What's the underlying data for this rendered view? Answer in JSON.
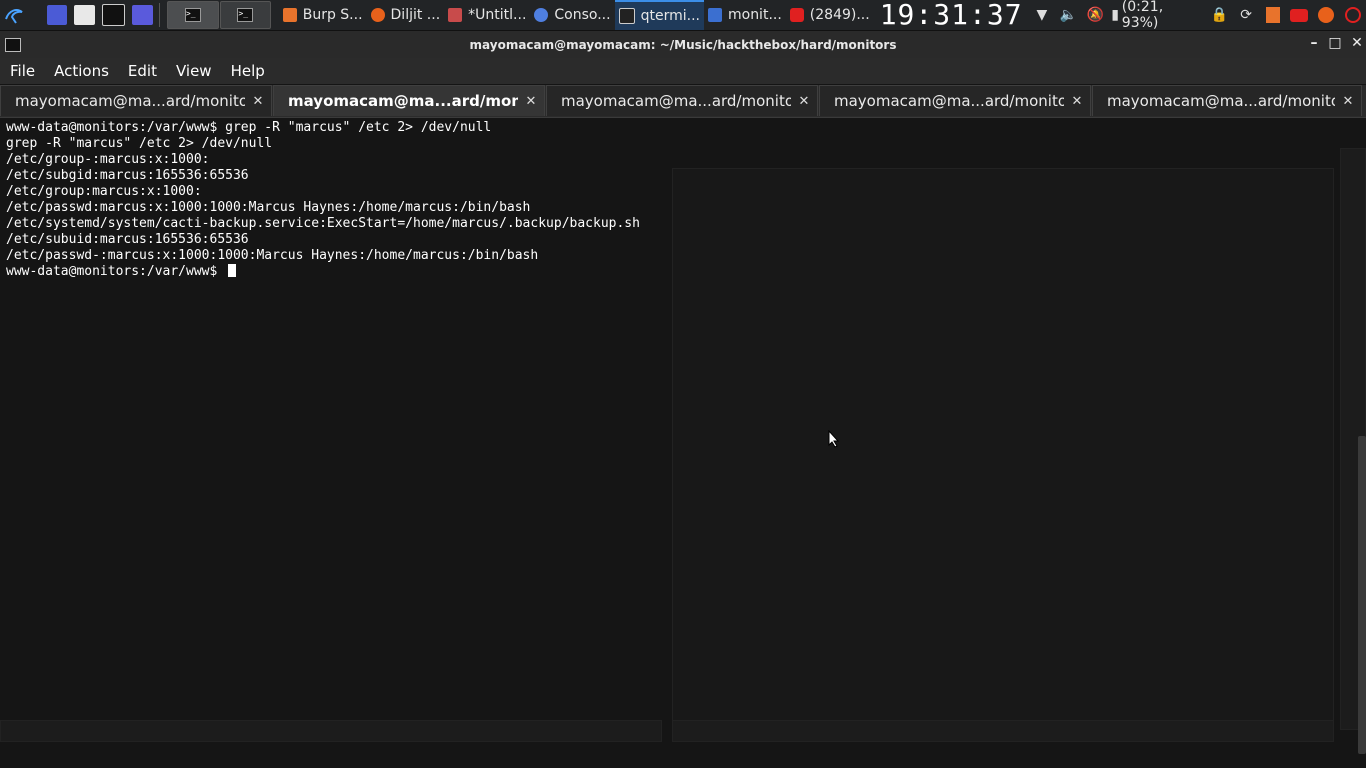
{
  "taskbar": {
    "tasks": [
      {
        "label": "Burp S...",
        "color": "#e8732c"
      },
      {
        "label": "Diljit ...",
        "color": "#e8611b"
      },
      {
        "label": "*Untitl...",
        "color": "#c84b4b"
      },
      {
        "label": "Conso...",
        "color": "#4f7fe0"
      },
      {
        "label": "qtermi...",
        "color": "#cccccc"
      },
      {
        "label": "monit...",
        "color": "#3b6fd0"
      },
      {
        "label": "(2849)...",
        "color": "#e02020"
      }
    ],
    "clock": "19:31:37",
    "battery": "(0:21, 93%)"
  },
  "window": {
    "title": "mayomacam@mayomacam: ~/Music/hackthebox/hard/monitors"
  },
  "menu": [
    "File",
    "Actions",
    "Edit",
    "View",
    "Help"
  ],
  "tabs": [
    {
      "label": "mayomacam@ma...ard/monitors",
      "active": false
    },
    {
      "label": "mayomacam@ma...ard/monitors",
      "active": true
    },
    {
      "label": "mayomacam@ma...ard/monitors",
      "active": false
    },
    {
      "label": "mayomacam@ma...ard/monitors",
      "active": false
    },
    {
      "label": "mayomacam@ma...ard/monitors",
      "active": false
    }
  ],
  "terminal": {
    "lines": [
      "www-data@monitors:/var/www$ grep -R \"marcus\" /etc 2> /dev/null",
      "grep -R \"marcus\" /etc 2> /dev/null",
      "/etc/group-:marcus:x:1000:",
      "/etc/subgid:marcus:165536:65536",
      "/etc/group:marcus:x:1000:",
      "/etc/passwd:marcus:x:1000:1000:Marcus Haynes:/home/marcus:/bin/bash",
      "/etc/systemd/system/cacti-backup.service:ExecStart=/home/marcus/.backup/backup.sh",
      "/etc/subuid:marcus:165536:65536",
      "/etc/passwd-:marcus:x:1000:1000:Marcus Haynes:/home/marcus:/bin/bash"
    ],
    "prompt": "www-data@monitors:/var/www$ "
  }
}
